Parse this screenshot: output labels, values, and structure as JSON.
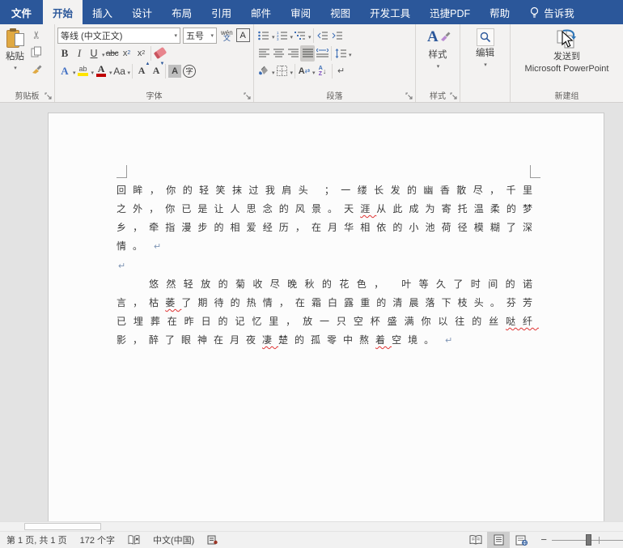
{
  "accent_color": "#2b579a",
  "squiggle_color": "#e03535",
  "tabs": [
    {
      "label": "文件"
    },
    {
      "label": "开始",
      "selected": true
    },
    {
      "label": "插入"
    },
    {
      "label": "设计"
    },
    {
      "label": "布局"
    },
    {
      "label": "引用"
    },
    {
      "label": "邮件"
    },
    {
      "label": "审阅"
    },
    {
      "label": "视图"
    },
    {
      "label": "开发工具"
    },
    {
      "label": "迅捷PDF"
    },
    {
      "label": "帮助"
    },
    {
      "label": "告诉我",
      "icon": "lightbulb"
    }
  ],
  "ribbon": {
    "clipboard": {
      "group_label": "剪贴板",
      "paste_label": "粘贴"
    },
    "font": {
      "group_label": "字体",
      "font_name": "等线 (中文正文)",
      "font_size": "五号",
      "bold": "B",
      "italic": "I",
      "underline": "U",
      "strikethrough": "abc",
      "subscript_base": "x",
      "subscript_sub": "2",
      "superscript_base": "x",
      "superscript_sup": "2",
      "change_case": "Aa",
      "phonetic_top": "wén",
      "phonetic_bottom": "文",
      "char_border": "A",
      "text_effects": "A",
      "highlight_label": "ab",
      "font_color_label": "A",
      "grow_font": "A",
      "shrink_font": "A",
      "char_shading": "A",
      "enclose_char": "字"
    },
    "paragraph": {
      "group_label": "段落",
      "sort_a": "A",
      "sort_z": "Z",
      "asian_layout": "A",
      "marks": "↵"
    },
    "styles": {
      "group_label": "样式",
      "button_label": "样式",
      "big_a": "A"
    },
    "editing": {
      "button_label": "编辑"
    },
    "new_group": {
      "group_label": "新建组",
      "button_label_line1": "发送到",
      "button_label_line2": "Microsoft PowerPoint"
    }
  },
  "document": {
    "pilcrow": "↵",
    "p1": [
      {
        "t": "回眸，你的轻笑抹过我肩头 ；一缕长发的幽香散尽，千里之外，你已是让人思念的风景。天"
      },
      {
        "t": "涯",
        "misspelled": true
      },
      {
        "t": "从此成为寄托温柔的梦乡，牵指漫步的相爱经历，在月华相依的小池荷径模糊了深情。"
      }
    ],
    "p2": [
      {
        "t": "悠然轻放的菊收尽晚秋的花色， 叶等久了时间的诺言，枯"
      },
      {
        "t": "萎",
        "misspelled": true
      },
      {
        "t": "了期待的热情，在霜白露重的清晨落下枝头。芬芳已埋葬在昨日的记忆里，放一只空杯盛满你以往的丝"
      },
      {
        "t": "哒纤",
        "misspelled": true
      },
      {
        "t": "影，醉了眼神在月夜"
      },
      {
        "t": "凄",
        "misspelled": true
      },
      {
        "t": "楚的孤零中熬"
      },
      {
        "t": "着",
        "misspelled": true
      },
      {
        "t": "空境。"
      }
    ]
  },
  "status_bar": {
    "page_info": "第 1 页, 共 1 页",
    "word_count": "172 个字",
    "language": "中文(中国)"
  }
}
